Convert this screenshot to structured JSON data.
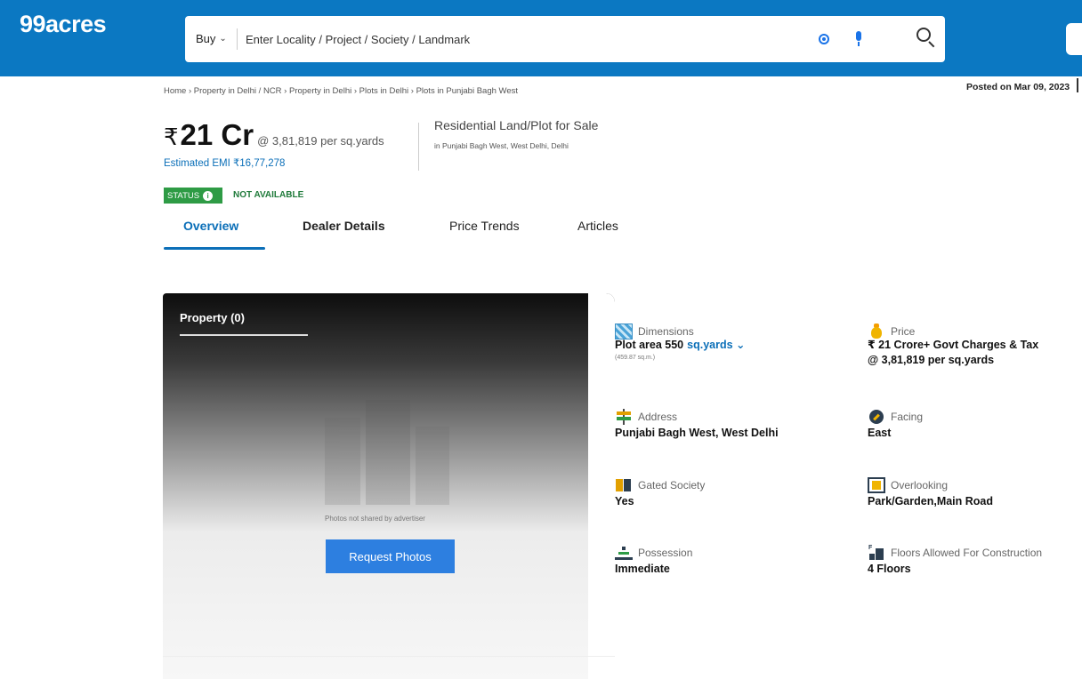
{
  "header": {
    "logo": "99acres",
    "buy_label": "Buy",
    "search_placeholder": "Enter Locality / Project / Society / Landmark"
  },
  "breadcrumb": [
    "Home",
    "Property in Delhi / NCR",
    "Property in Delhi",
    "Plots in Delhi",
    "Plots in Punjabi Bagh West"
  ],
  "posted_on": "Posted on Mar 09, 2023",
  "listing": {
    "currency_symbol": "₹",
    "price": "21 Cr",
    "price_per_unit": "@ 3,81,819 per sq.yards",
    "emi": "Estimated EMI ₹16,77,278",
    "title": "Residential Land/Plot for Sale",
    "location": "in Punjabi Bagh West, West Delhi, Delhi"
  },
  "status": {
    "badge": "STATUS",
    "value": "NOT AVAILABLE"
  },
  "tabs": [
    {
      "label": "Overview",
      "active": true
    },
    {
      "label": "Dealer Details",
      "active": false
    },
    {
      "label": "Price Trends",
      "active": false
    },
    {
      "label": "Articles",
      "active": false
    }
  ],
  "photo_panel": {
    "tab_label": "Property (0)",
    "no_photos_text": "Photos not shared by advertiser",
    "request_button": "Request Photos"
  },
  "details": {
    "dimensions": {
      "label": "Dimensions",
      "value": "Plot area 550",
      "unit": "sq.yards",
      "sub": "(459.87 sq.m.)"
    },
    "price": {
      "label": "Price",
      "value": "₹ 21 Crore+ Govt Charges & Tax",
      "value2": "@ 3,81,819 per sq.yards"
    },
    "address": {
      "label": "Address",
      "value": "Punjabi Bagh West, West Delhi"
    },
    "facing": {
      "label": "Facing",
      "value": "East"
    },
    "gated_society": {
      "label": "Gated Society",
      "value": "Yes"
    },
    "overlooking": {
      "label": "Overlooking",
      "value": "Park/Garden,Main Road"
    },
    "possession": {
      "label": "Possession",
      "value": "Immediate"
    },
    "floors": {
      "label": "Floors Allowed For Construction",
      "value": "4 Floors"
    }
  },
  "colors": {
    "header_bg": "#0b78c2",
    "accent": "#0b6fb8",
    "status_green": "#2e9b45",
    "button_blue": "#2d7fe0"
  }
}
